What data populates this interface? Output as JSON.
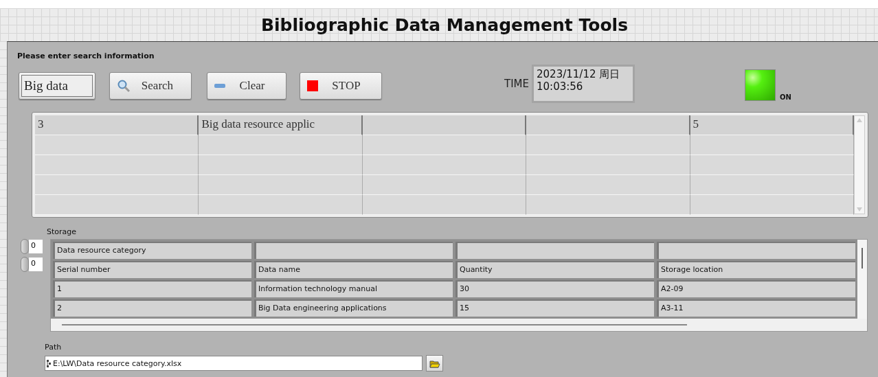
{
  "title": "Bibliographic Data Management Tools",
  "search_label": "Please enter search information",
  "search_field": {
    "value": "Big data"
  },
  "buttons": [
    {
      "kind": "search",
      "label": "Search"
    },
    {
      "kind": "clear",
      "label": "Clear"
    },
    {
      "kind": "stop",
      "label": "STOP"
    }
  ],
  "time": {
    "label": "TIME",
    "date": "2023/11/12 周日",
    "clock": "10:03:56"
  },
  "indicator": {
    "label": "ON",
    "on": true
  },
  "results_table": {
    "rows": [
      {
        "column_1": "3",
        "column_2": "Big data resource applic",
        "column_5": "5"
      }
    ]
  },
  "storage": {
    "label": "Storage",
    "row_index": "0",
    "column_index": "0",
    "rows": [
      {
        "column_1": "Data resource category"
      },
      {
        "column_1": "Serial number",
        "column_2": "Data name",
        "column_3": "Quantity",
        "column_4": "Storage location"
      },
      {
        "column_1": "1",
        "column_2": "Information technology manual",
        "column_3": "30",
        "column_4": "A2-09"
      },
      {
        "column_1": "2",
        "column_2": "Big Data engineering applications",
        "column_3": "15",
        "column_4": "A3-11"
      }
    ]
  },
  "path": {
    "label": "Path",
    "value": "E:\\LW\\Data resource category.xlsx"
  }
}
